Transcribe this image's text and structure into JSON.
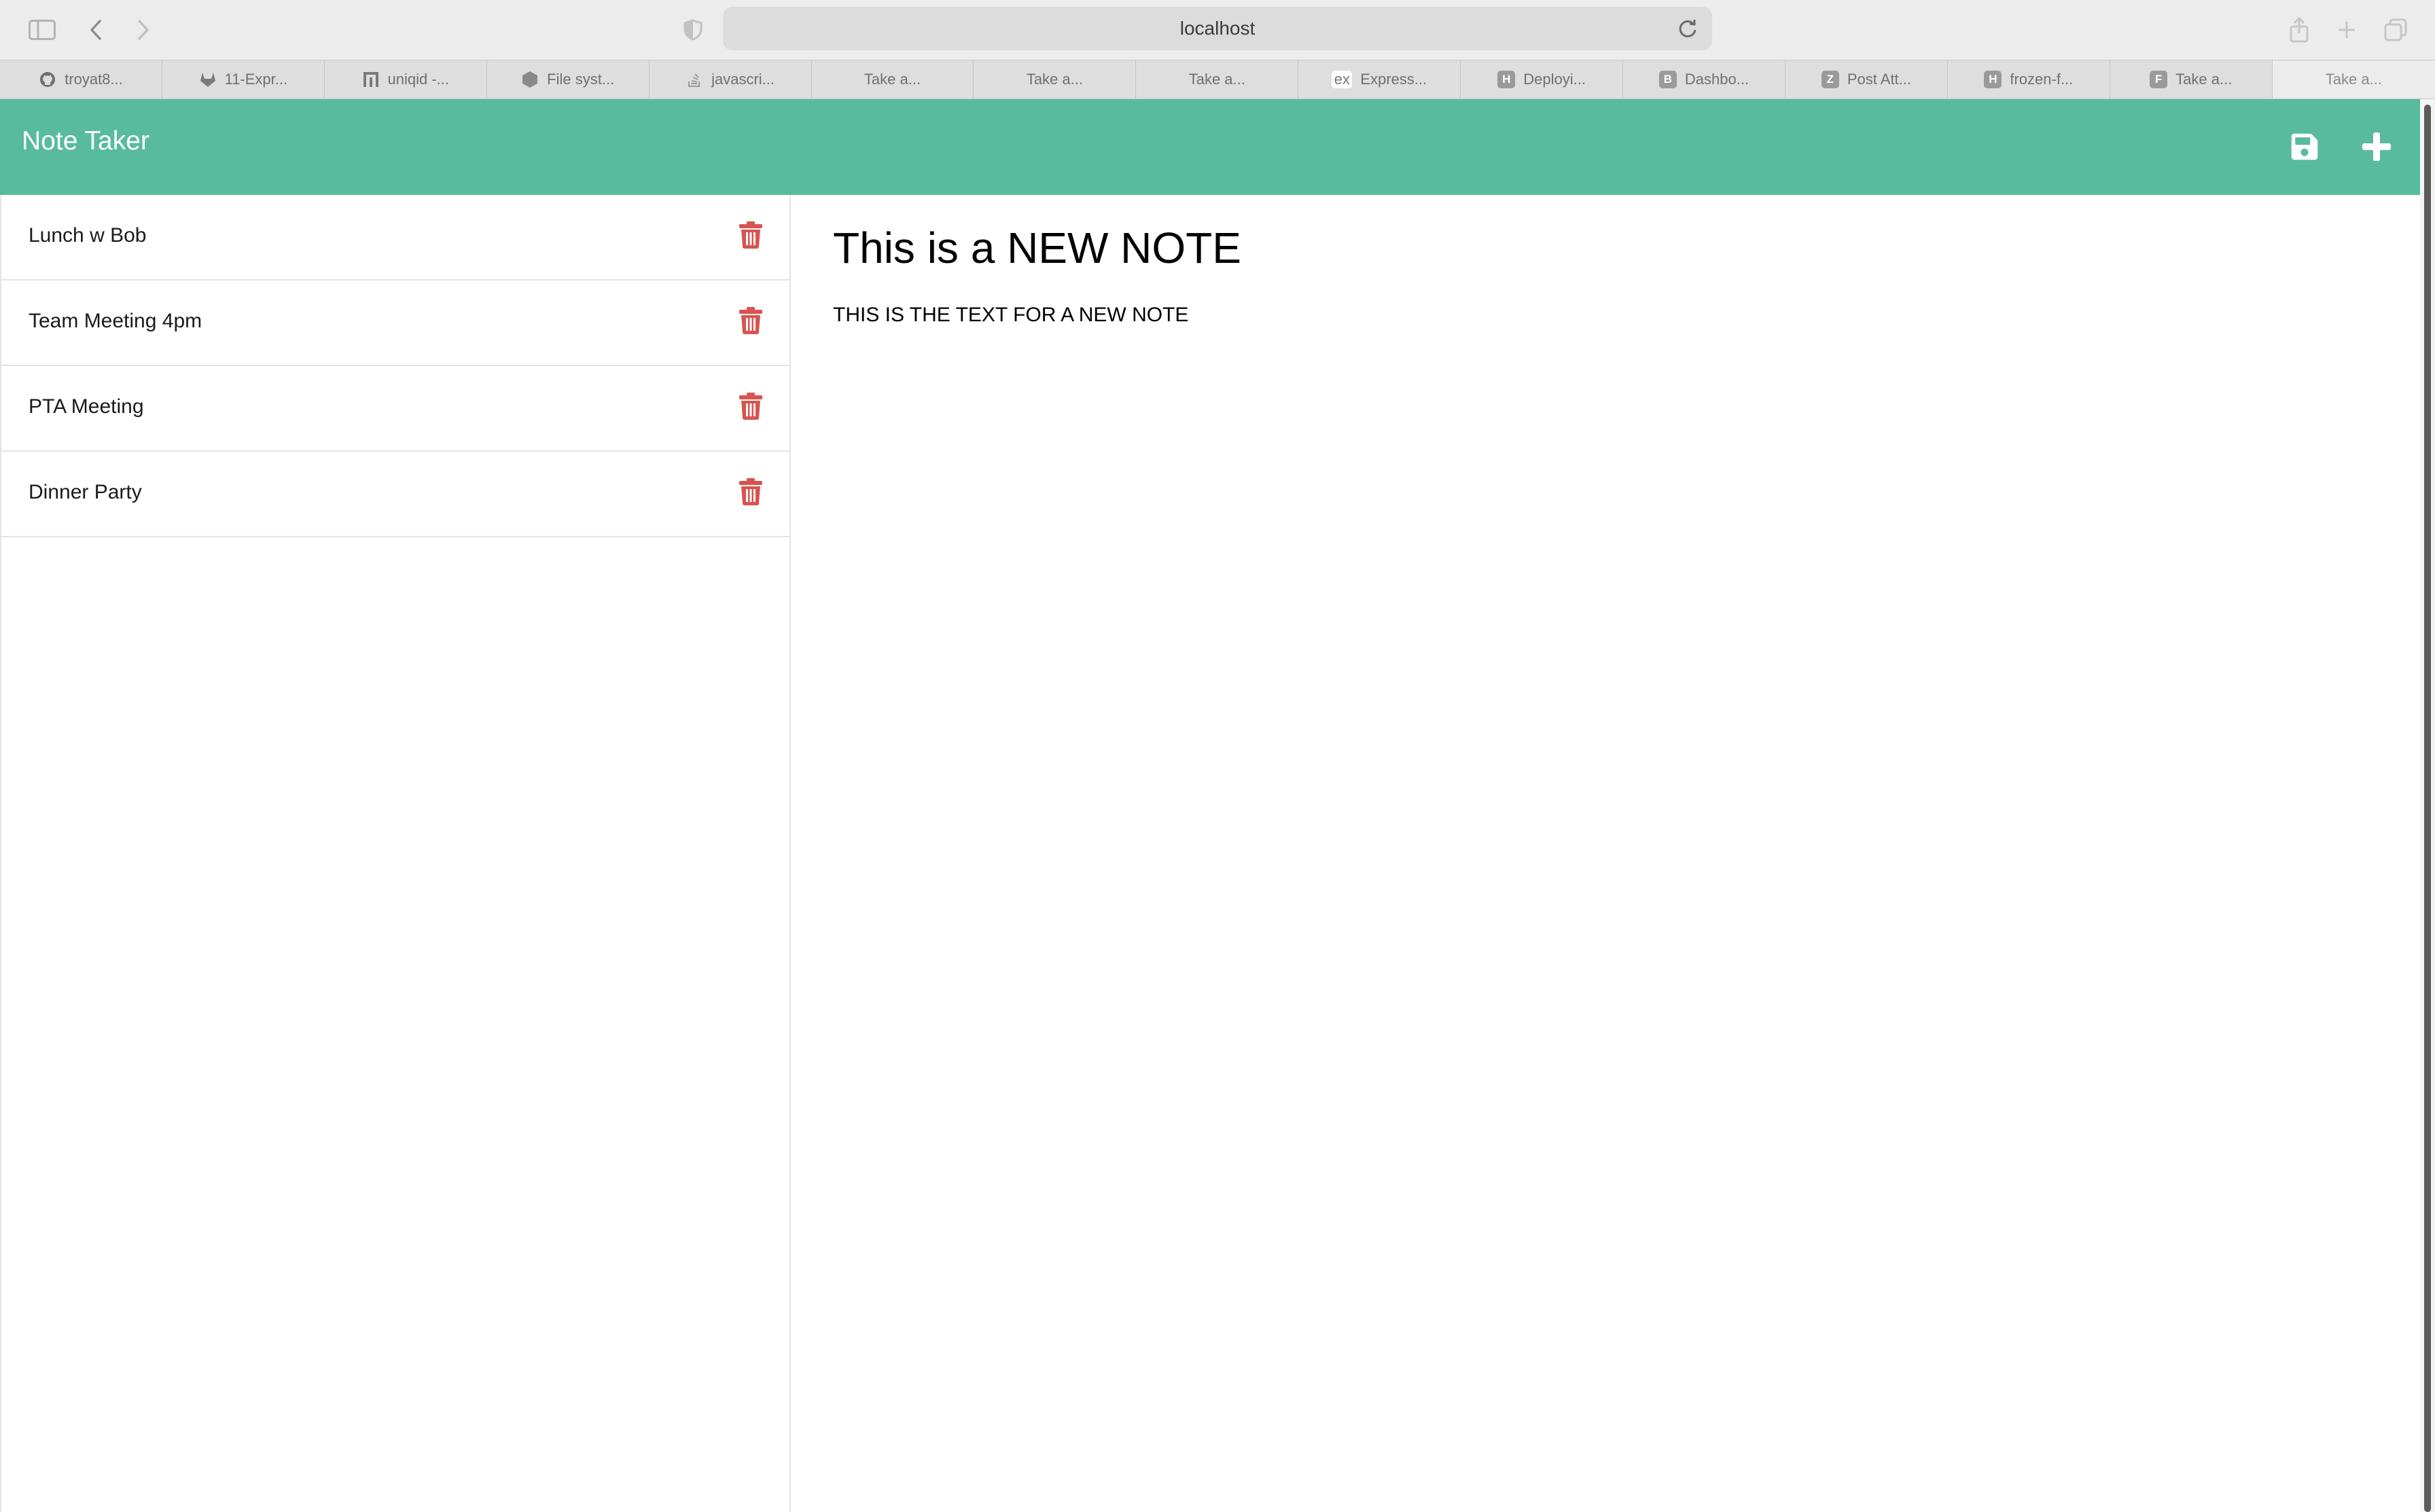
{
  "browser": {
    "url": "localhost",
    "tabs": [
      {
        "label": "troyat8...",
        "icon": "github-icon",
        "favicon_text": ""
      },
      {
        "label": "11-Expr...",
        "icon": "gitlab-icon",
        "favicon_text": ""
      },
      {
        "label": "uniqid -...",
        "icon": "npm-icon",
        "favicon_text": ""
      },
      {
        "label": "File syst...",
        "icon": "nodejs-icon",
        "favicon_text": ""
      },
      {
        "label": "javascri...",
        "icon": "stackoverflow-icon",
        "favicon_text": ""
      },
      {
        "label": "Take a...",
        "icon": "",
        "favicon_text": ""
      },
      {
        "label": "Take a...",
        "icon": "",
        "favicon_text": ""
      },
      {
        "label": "Take a...",
        "icon": "",
        "favicon_text": ""
      },
      {
        "label": "Express...",
        "icon": "express-icon",
        "favicon_text": "ex"
      },
      {
        "label": "Deployi...",
        "icon": "heroku-icon",
        "favicon_text": "H"
      },
      {
        "label": "Dashbo...",
        "icon": "bootcamp-icon",
        "favicon_text": "B"
      },
      {
        "label": "Post Att...",
        "icon": "zoom-icon",
        "favicon_text": "Z"
      },
      {
        "label": "frozen-f...",
        "icon": "heroku-icon",
        "favicon_text": "H"
      },
      {
        "label": "Take a...",
        "icon": "f-icon",
        "favicon_text": "F"
      },
      {
        "label": "Take a...",
        "icon": "",
        "favicon_text": "",
        "active": true
      }
    ]
  },
  "app": {
    "title": "Note Taker",
    "accent_color": "#58bb9e",
    "delete_color": "#d9534f",
    "save_icon": "save-icon",
    "new_icon": "plus-icon"
  },
  "notes": [
    {
      "title": "Lunch w Bob"
    },
    {
      "title": "Team Meeting 4pm"
    },
    {
      "title": "PTA Meeting"
    },
    {
      "title": "Dinner Party"
    }
  ],
  "editor": {
    "title_value": "This is a NEW NOTE",
    "text_value": "THIS IS THE TEXT FOR A NEW NOTE"
  }
}
